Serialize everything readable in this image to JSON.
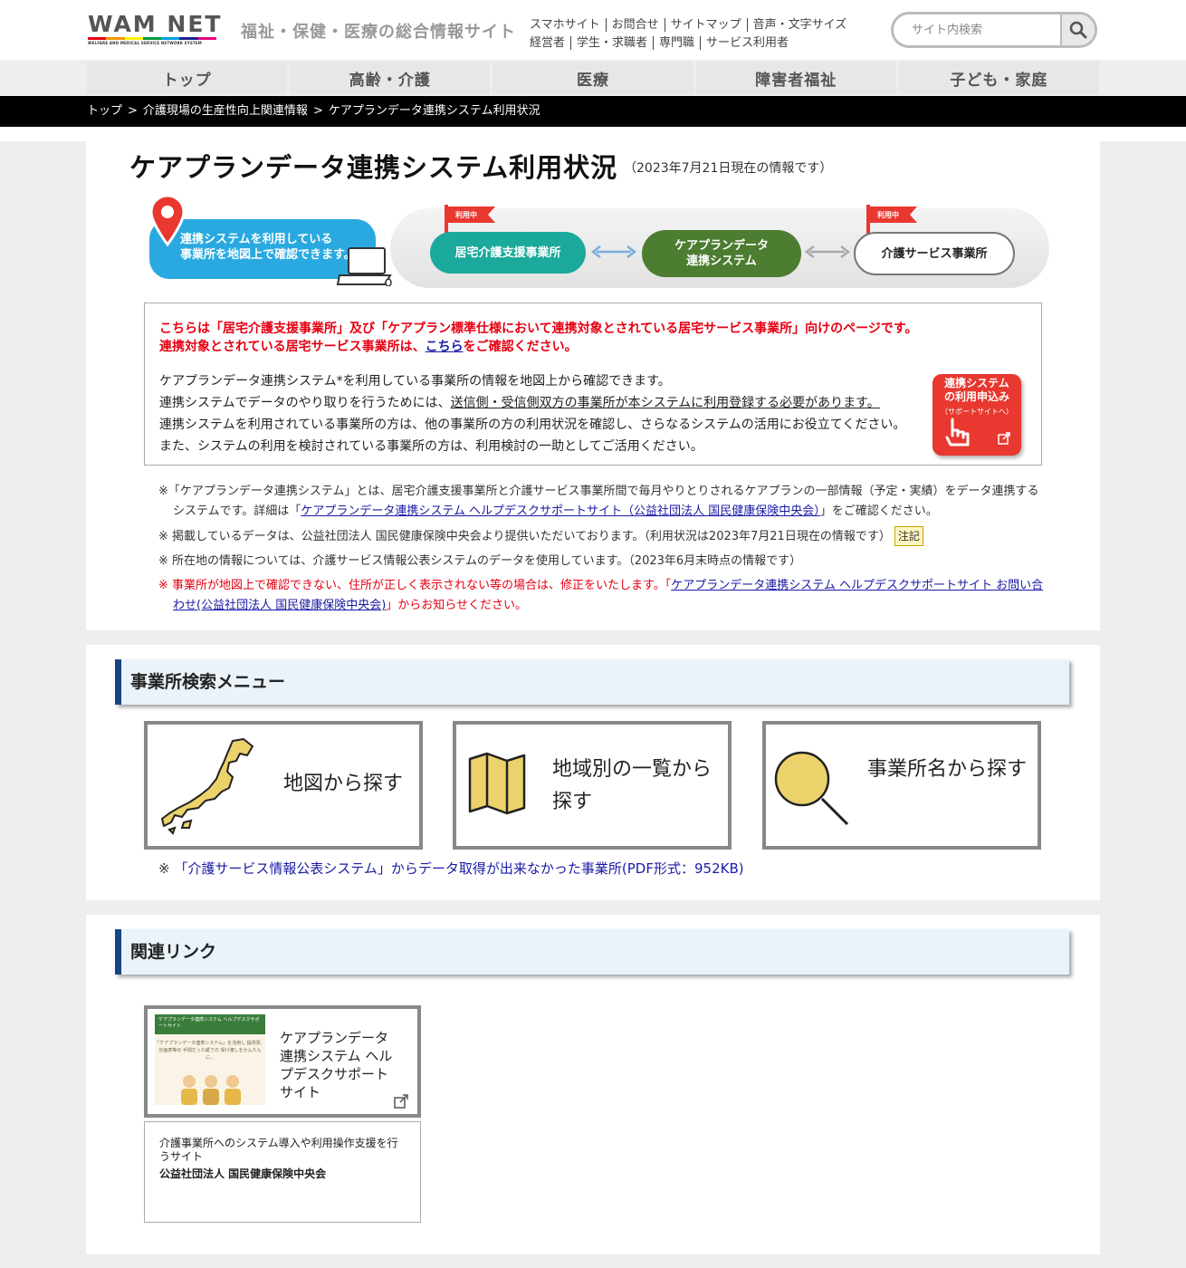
{
  "header": {
    "logo_text_1": "WAM",
    "logo_text_2": "NET",
    "logo_sub": "WELFARE AND MEDICAL SERVICE NETWORK SYSTEM",
    "tagline": "福祉・保健・医療の総合情報サイト",
    "util_row1": [
      "スマホサイト",
      "お問合せ",
      "サイトマップ",
      "音声・文字サイズ"
    ],
    "util_row2": [
      "経営者",
      "学生・求職者",
      "専門職",
      "サービス利用者"
    ],
    "search_placeholder": "サイト内検索",
    "logo_colors": [
      "#e60012",
      "#f39800",
      "#fff100",
      "#009944",
      "#00a0e9",
      "#1d2088",
      "#e4007f"
    ]
  },
  "nav": [
    "トップ",
    "高齢・介護",
    "医療",
    "障害者福祉",
    "子ども・家庭"
  ],
  "breadcrumb": [
    "トップ",
    "介護現場の生産性向上関連情報",
    "ケアプランデータ連携システム利用状況"
  ],
  "page": {
    "title": "ケアプランデータ連携システム利用状況",
    "date": "（2023年7月21日現在の情報です）"
  },
  "banner": {
    "blue_line1": "連携システムを利用している",
    "blue_line2": "事業所を地図上で確認できます。",
    "flag_label": "利用中",
    "node_a": "居宅介護支援事業所",
    "node_b_1": "ケアプランデータ",
    "node_b_2": "連携システム",
    "node_c": "介護サービス事業所"
  },
  "notice": {
    "red1": "こちらは「居宅介護支援事業所」及び「ケアプラン標準仕様において連携対象とされている居宅サービス事業所」向けのページです。",
    "red2_pre": "連携対象とされている居宅サービス事業所は、",
    "red2_link": "こちら",
    "red2_post": "をご確認ください。",
    "body1": "ケアプランデータ連携システム*を利用している事業所の情報を地図上から確認できます。",
    "body2_pre": "連携システムでデータのやり取りを行うためには、",
    "body2_ul": "送信側・受信側双方の事業所が本システムに利用登録する必要があります。",
    "body3": "連携システムを利用されている事業所の方は、他の事業所の方の利用状況を確認し、さらなるシステムの活用にお役立てください。",
    "body4": "また、システムの利用を検討されている事業所の方は、利用検討の一助としてご活用ください。",
    "apply_1": "連携システム",
    "apply_2": "の利用申込み",
    "apply_3": "（サポートサイトへ）"
  },
  "notes": {
    "n1_pre": "※「ケアプランデータ連携システム」とは、居宅介護支援事業所と介護サービス事業所間で毎月やりとりされるケアプランの一部情報（予定・実績）をデータ連携するシステムです。詳細は「",
    "n1_link": "ケアプランデータ連携システム ヘルプデスクサポートサイト（公益社団法人 国民健康保険中央会）",
    "n1_post": "」をご確認ください。",
    "n2": "※ 掲載しているデータは、公益社団法人 国民健康保険中央会より提供いただいております。（利用状況は2023年7月21日現在の情報です）",
    "n2_tag": "注記",
    "n3": "※ 所在地の情報については、介護サービス情報公表システムのデータを使用しています。（2023年6月末時点の情報です）",
    "n4_pre": "※ 事業所が地図上で確認できない、住所が正しく表示されない等の場合は、修正をいたします。「",
    "n4_link": "ケアプランデータ連携システム ヘルプデスクサポートサイト お問い合わせ(公益社団法人 国民健康保険中央会)",
    "n4_post": "」からお知らせください。"
  },
  "search_menu": {
    "heading": "事業所検索メニュー",
    "cards": [
      {
        "label": "地図から探す",
        "icon": "japan-map-icon"
      },
      {
        "label": "地域別の一覧から探す",
        "icon": "folded-map-icon"
      },
      {
        "label": "事業所名から探す",
        "icon": "magnifier-icon"
      }
    ],
    "pdf_mark": "※",
    "pdf_link": "「介護サービス情報公表システム」からデータ取得が出来なかった事業所(PDF形式：952KB)"
  },
  "related": {
    "heading": "関連リンク",
    "card_title": "ケアプランデータ連携システム ヘルプデスクサポートサイト",
    "thumb_top": "ケアプランデータ連携システム ヘルプデスクサポートサイト",
    "thumb_text": "「ケアプランデータ連携システム」を活用し 提供票、計画表等の 手間だった紙での 受け渡しをかんたんに。",
    "desc": "介護事業所へのシステム導入や利用操作支援を行うサイト",
    "org": "公益社団法人 国民健康保険中央会"
  }
}
